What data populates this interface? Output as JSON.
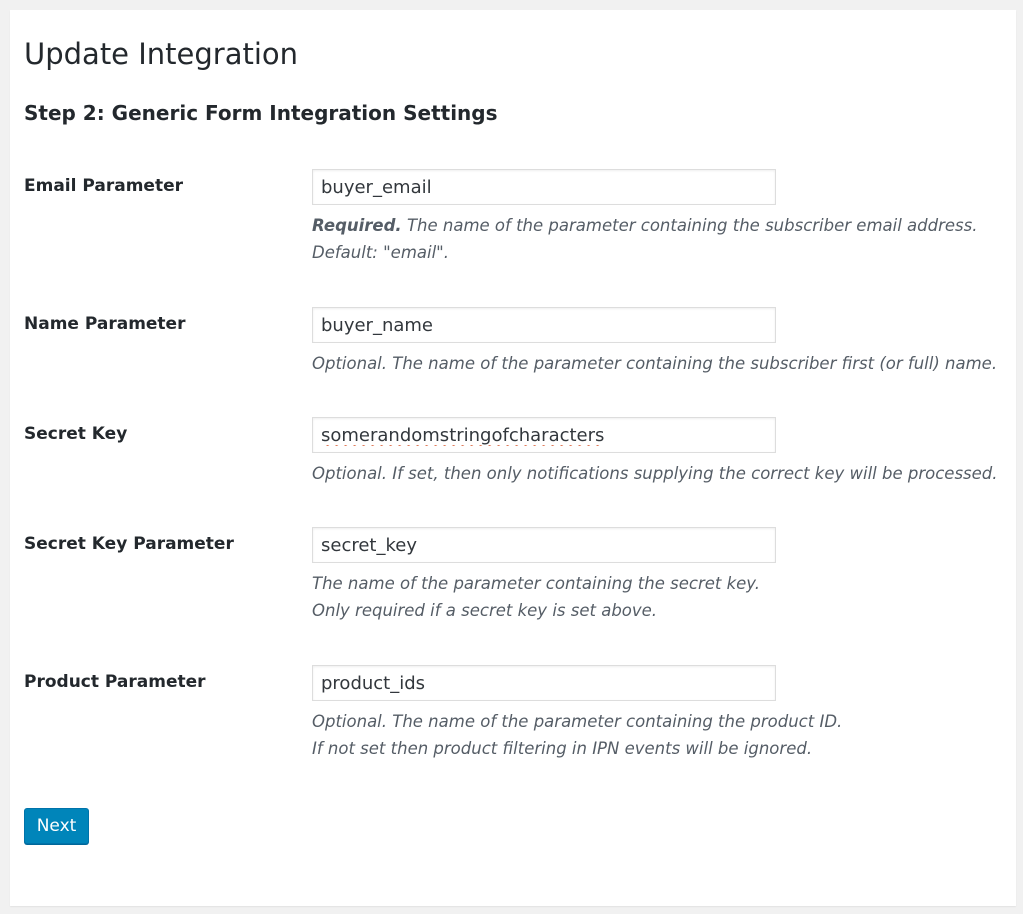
{
  "page": {
    "title": "Update Integration",
    "section_title": "Step 2: Generic Form Integration Settings"
  },
  "fields": [
    {
      "label": "Email Parameter",
      "value": "buyer_email",
      "desc_strong": "Required.",
      "desc_lines": [
        " The name of the parameter containing the subscriber email address.",
        "Default: \"email\"."
      ]
    },
    {
      "label": "Name Parameter",
      "value": "buyer_name",
      "desc_lines": [
        "Optional. The name of the parameter containing the subscriber first (or full) name."
      ]
    },
    {
      "label": "Secret Key",
      "value": "somerandomstringofcharacters",
      "desc_lines": [
        "Optional. If set, then only notifications supplying the correct key will be processed."
      ]
    },
    {
      "label": "Secret Key Parameter",
      "value": "secret_key",
      "desc_lines": [
        "The name of the parameter containing the secret key.",
        "Only required if a secret key is set above."
      ]
    },
    {
      "label": "Product Parameter",
      "value": "product_ids",
      "desc_lines": [
        "Optional. The name of the parameter containing the product ID.",
        "If not set then product filtering in IPN events will be ignored."
      ]
    }
  ],
  "actions": {
    "next_label": "Next"
  },
  "colors": {
    "primary_button": "#0085ba",
    "background": "#f1f1f1",
    "panel": "#ffffff",
    "description_text": "#555d66"
  }
}
